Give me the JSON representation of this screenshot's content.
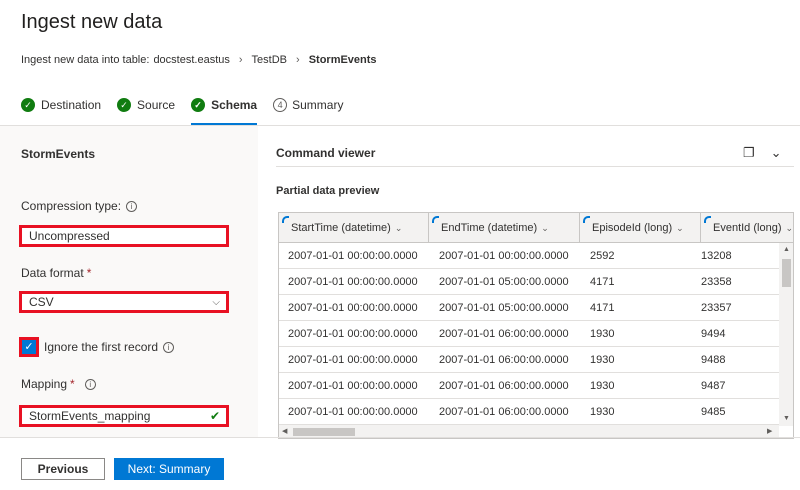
{
  "page": {
    "title": "Ingest new data"
  },
  "breadcrumb": {
    "prefix": "Ingest new data into table:",
    "cluster": "docstest.eastus",
    "database": "TestDB",
    "table": "StormEvents"
  },
  "steps": [
    {
      "label": "Destination",
      "state": "done"
    },
    {
      "label": "Source",
      "state": "done"
    },
    {
      "label": "Schema",
      "state": "active"
    },
    {
      "label": "Summary",
      "number": "4",
      "state": "pending"
    }
  ],
  "left": {
    "table_name": "StormEvents",
    "compression_label": "Compression type:",
    "compression_value": "Uncompressed",
    "format_label": "Data format",
    "format_value": "CSV",
    "ignore_label": "Ignore the first record",
    "mapping_label": "Mapping",
    "mapping_value": "StormEvents_mapping",
    "required_mark": "*"
  },
  "right": {
    "command_viewer": "Command viewer",
    "preview_title": "Partial data preview",
    "columns": [
      "StartTime (datetime)",
      "EndTime (datetime)",
      "EpisodeId (long)",
      "EventId (long)"
    ],
    "rows": [
      [
        "2007-01-01 00:00:00.0000",
        "2007-01-01 00:00:00.0000",
        "2592",
        "13208"
      ],
      [
        "2007-01-01 00:00:00.0000",
        "2007-01-01 05:00:00.0000",
        "4171",
        "23358"
      ],
      [
        "2007-01-01 00:00:00.0000",
        "2007-01-01 05:00:00.0000",
        "4171",
        "23357"
      ],
      [
        "2007-01-01 00:00:00.0000",
        "2007-01-01 06:00:00.0000",
        "1930",
        "9494"
      ],
      [
        "2007-01-01 00:00:00.0000",
        "2007-01-01 06:00:00.0000",
        "1930",
        "9488"
      ],
      [
        "2007-01-01 00:00:00.0000",
        "2007-01-01 06:00:00.0000",
        "1930",
        "9487"
      ],
      [
        "2007-01-01 00:00:00.0000",
        "2007-01-01 06:00:00.0000",
        "1930",
        "9485"
      ]
    ]
  },
  "footer": {
    "previous": "Previous",
    "next": "Next: Summary"
  },
  "colors": {
    "accent": "#0078d4",
    "success": "#107c10",
    "highlight": "#e81123"
  }
}
